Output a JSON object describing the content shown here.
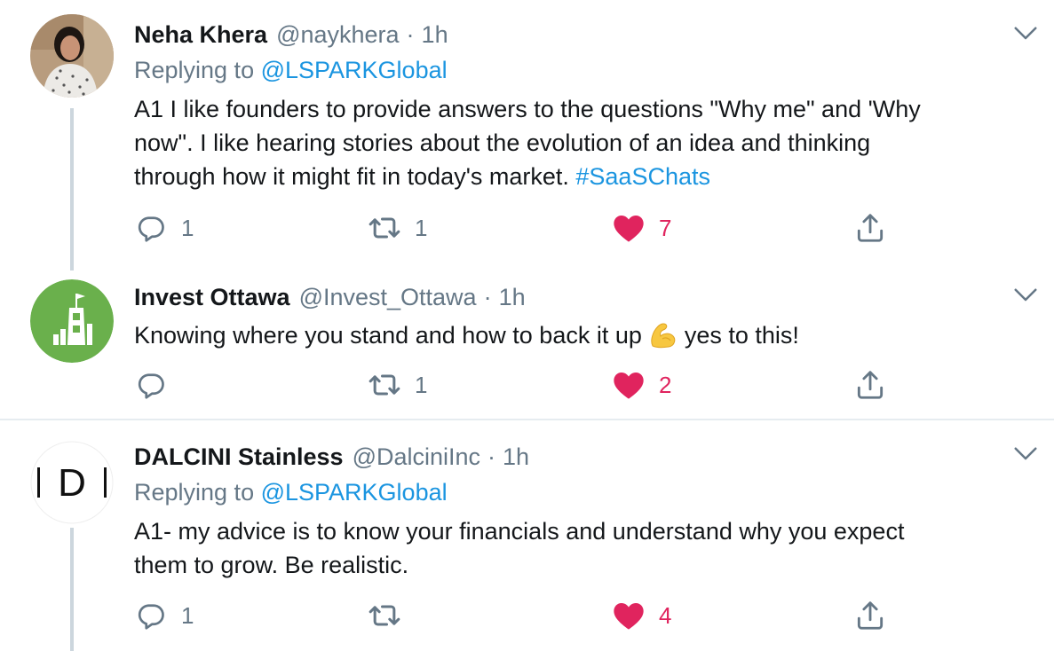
{
  "tweets": [
    {
      "name": "Neha Khera",
      "handle": "@naykhera",
      "separator": "·",
      "time": "1h",
      "replying_prefix": "Replying to ",
      "replying_to": "@LSPARKGlobal",
      "text_line1": "A1 I like founders to provide answers to the questions \"Why me\" and 'Why",
      "text_line2": "now\". I like hearing stories about the evolution of an idea and thinking",
      "text_line3": "through how it might fit in today's market. ",
      "hashtag": "#SaaSChats",
      "reply_count": "1",
      "retweet_count": "1",
      "like_count": "7"
    },
    {
      "name": "Invest Ottawa",
      "handle": "@Invest_Ottawa",
      "separator": "·",
      "time": "1h",
      "text_before_emoji": "Knowing where you stand and how to back it up",
      "text_after_emoji": "yes to this!",
      "emoji": "flexed-biceps",
      "reply_count": "",
      "retweet_count": "1",
      "like_count": "2"
    },
    {
      "name": "DALCINI Stainless",
      "handle": "@DalciniInc",
      "separator": "·",
      "time": "1h",
      "avatar_letter": "D",
      "replying_prefix": "Replying to ",
      "replying_to": "@LSPARKGlobal",
      "text_line1": "A1- my advice is to know your financials and understand why you expect",
      "text_line2": "them to grow. Be realistic.",
      "reply_count": "1",
      "retweet_count": "",
      "like_count": "4"
    }
  ],
  "colors": {
    "link": "#1b95e0",
    "secondary_text": "#657786",
    "like_red": "#e0245e",
    "border": "#e6ecf0",
    "thread_line": "#ccd6dd",
    "invest_ottawa_green": "#6ab04c"
  }
}
